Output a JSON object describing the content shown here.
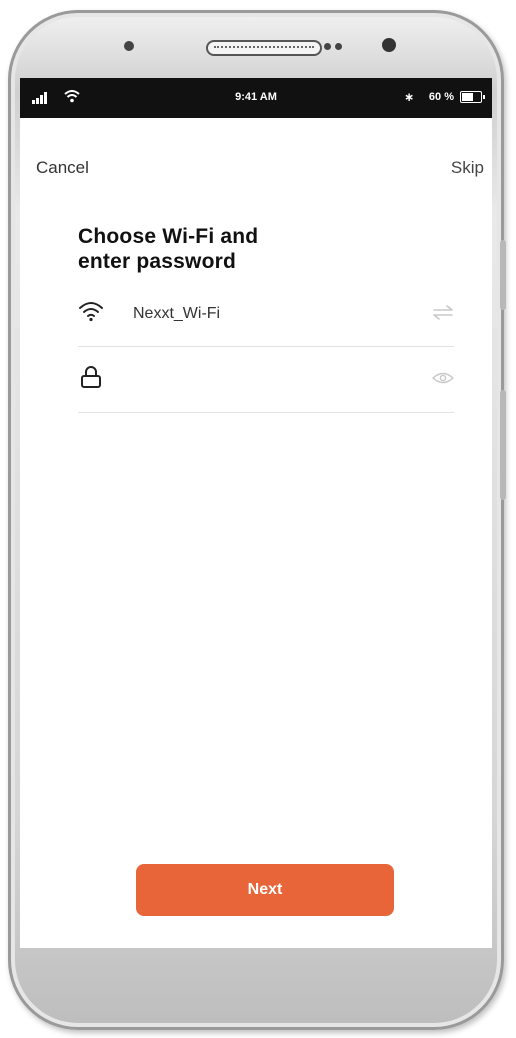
{
  "status_bar": {
    "time": "9:41 AM",
    "battery": "60 %",
    "bluetooth": "∗"
  },
  "nav": {
    "cancel": "Cancel",
    "skip": "Skip"
  },
  "title_line1": "Choose Wi-Fi and",
  "title_line2": "enter password",
  "wifi_row": {
    "network_name": "Nexxt_Wi-Fi",
    "icon": "wifi-icon",
    "trailing_icon": "switch-network-icon"
  },
  "password_row": {
    "value": "",
    "icon": "lock-icon",
    "trailing_icon": "eye-icon"
  },
  "next_button": "Next",
  "colors": {
    "accent": "#e8653a",
    "status_bar": "#111111"
  }
}
